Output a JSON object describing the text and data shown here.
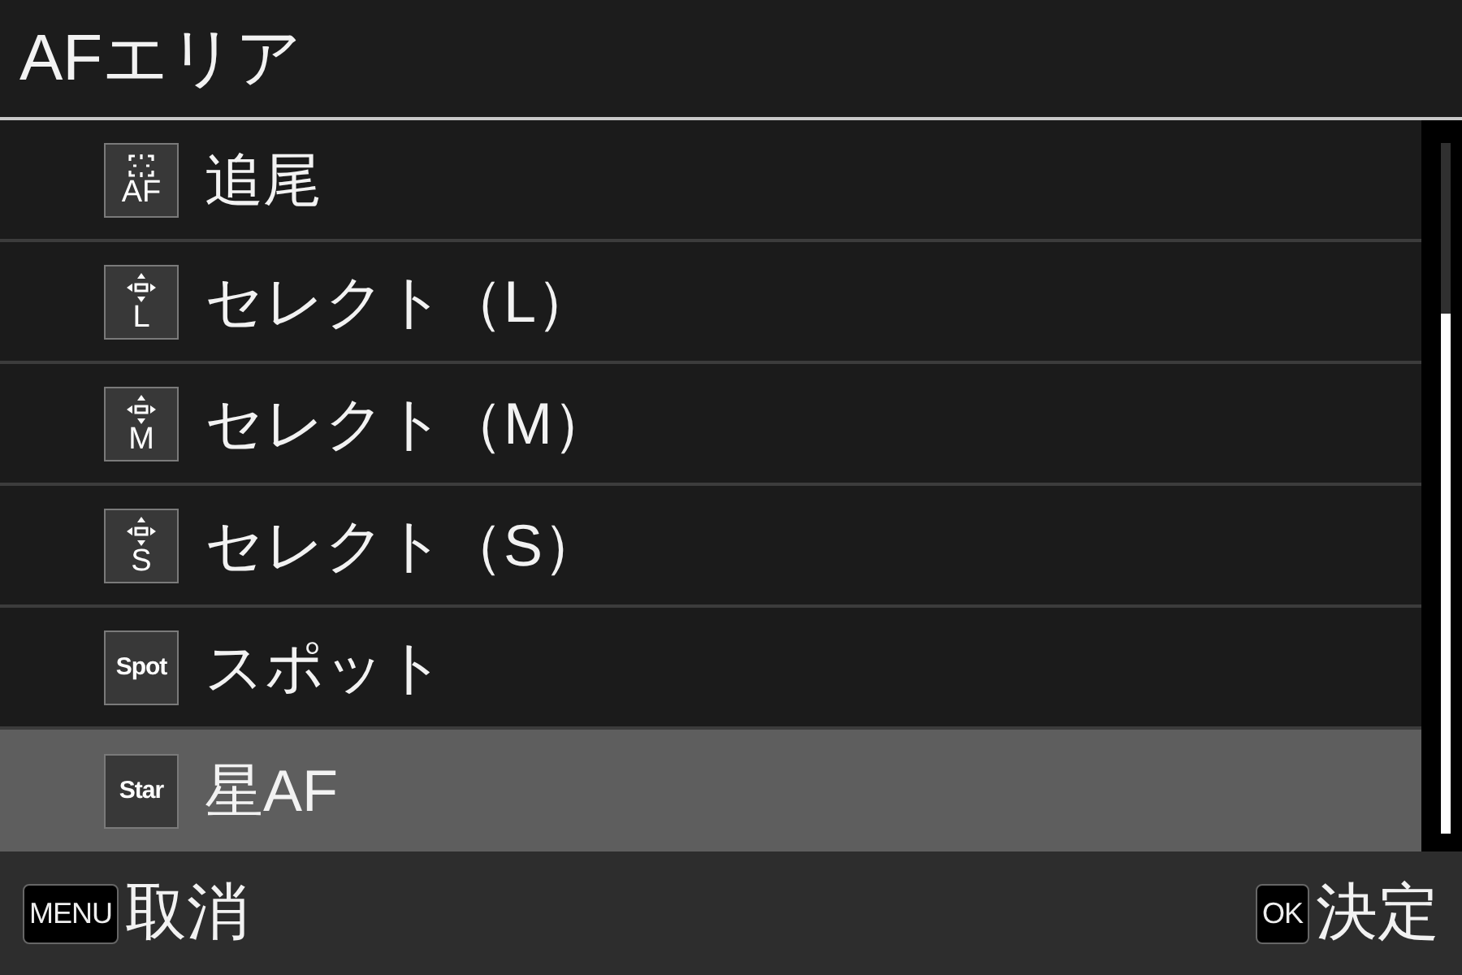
{
  "screen": {
    "title": "AFエリア"
  },
  "options": [
    {
      "kind": "tracking",
      "icon_label": "AF",
      "label": "追尾",
      "selected": false
    },
    {
      "kind": "select",
      "icon_label": "L",
      "label": "セレクト（L）",
      "selected": false
    },
    {
      "kind": "select",
      "icon_label": "M",
      "label": "セレクト（M）",
      "selected": false
    },
    {
      "kind": "select",
      "icon_label": "S",
      "label": "セレクト（S）",
      "selected": false
    },
    {
      "kind": "text",
      "icon_label": "Spot",
      "label": "スポット",
      "selected": false
    },
    {
      "kind": "text",
      "icon_label": "Star",
      "label": "星AF",
      "selected": true
    }
  ],
  "footer": [
    {
      "key": "MENU",
      "label": "取消"
    },
    {
      "key": "OK",
      "label": "決定"
    }
  ]
}
